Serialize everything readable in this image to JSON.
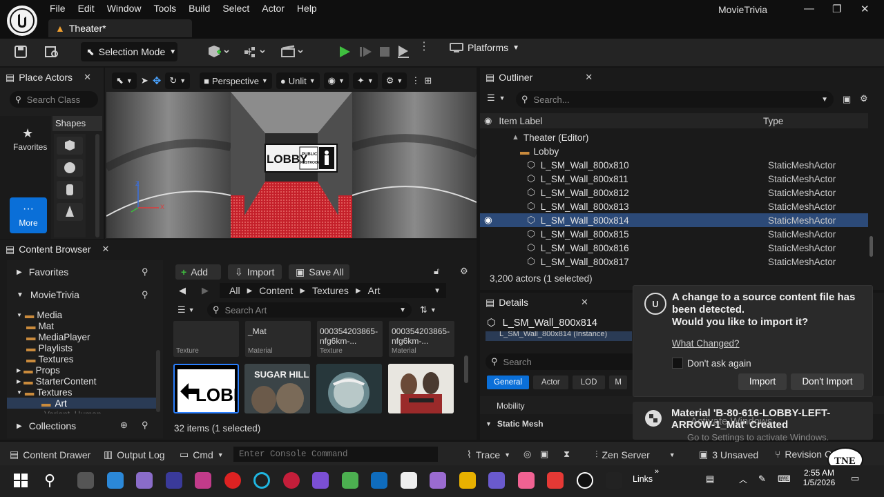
{
  "app": {
    "window_title": "MovieTrivia",
    "level_tab": "Theater*"
  },
  "menu": [
    "File",
    "Edit",
    "Window",
    "Tools",
    "Build",
    "Select",
    "Actor",
    "Help"
  ],
  "toolbar": {
    "selection_mode": "Selection Mode",
    "platforms": "Platforms"
  },
  "place_actors": {
    "title": "Place Actors",
    "search_placeholder": "Search Class",
    "favorites": "Favorites",
    "more": "More",
    "shapes": "Shapes"
  },
  "viewport": {
    "perspective": "Perspective",
    "unlit": "Unlit",
    "sign_lobby": "LOBBY",
    "sign_public": "PUBLIC",
    "sign_restroom": "RESTROOM",
    "axis_z": "Z",
    "axis_x": "X"
  },
  "outliner": {
    "title": "Outliner",
    "search_placeholder": "Search...",
    "col_label": "Item Label",
    "col_type": "Type",
    "root": "Theater (Editor)",
    "folder": "Lobby",
    "rows": [
      {
        "label": "L_SM_Wall_800x810",
        "type": "StaticMeshActor"
      },
      {
        "label": "L_SM_Wall_800x811",
        "type": "StaticMeshActor"
      },
      {
        "label": "L_SM_Wall_800x812",
        "type": "StaticMeshActor"
      },
      {
        "label": "L_SM_Wall_800x813",
        "type": "StaticMeshActor"
      },
      {
        "label": "L_SM_Wall_800x814",
        "type": "StaticMeshActor"
      },
      {
        "label": "L_SM_Wall_800x815",
        "type": "StaticMeshActor"
      },
      {
        "label": "L_SM_Wall_800x816",
        "type": "StaticMeshActor"
      },
      {
        "label": "L_SM_Wall_800x817",
        "type": "StaticMeshActor"
      }
    ],
    "status": "3,200 actors (1 selected)"
  },
  "content_browser": {
    "title": "Content Browser",
    "favorites": "Favorites",
    "project": "MovieTrivia",
    "tree": [
      "Media",
      "Mat",
      "MediaPlayer",
      "Playlists",
      "Textures",
      "Props",
      "StarterContent",
      "Textures",
      "Art"
    ],
    "tree_cut": "Variant_Human",
    "collections": "Collections",
    "add": "Add",
    "import": "Import",
    "save_all": "Save All",
    "breadcrumb": [
      "All",
      "Content",
      "Textures",
      "Art"
    ],
    "search_placeholder": "Search Art",
    "assets_top": [
      {
        "name": "",
        "type": "Texture"
      },
      {
        "name": "_Mat",
        "type": "Material"
      },
      {
        "name": "000354203865-nfg6km-...",
        "type": "Texture"
      },
      {
        "name": "000354203865-nfg6km-...",
        "type": "Material"
      }
    ],
    "thumb_lobby": "LOBBY",
    "thumb_sugarhill": "SUGAR HILL",
    "status": "32 items (1 selected)"
  },
  "details": {
    "title": "Details",
    "actor": "L_SM_Wall_800x814",
    "instance": "L_SM_Wall_800x814 (Instance)",
    "search_placeholder": "Search",
    "tabs": [
      "General",
      "Actor",
      "LOD",
      "M"
    ],
    "mobility": "Mobility",
    "static_mesh": "Static Mesh"
  },
  "notification": {
    "title": "A change to a source content file has been detected.",
    "question": "Would you like to import it?",
    "what_changed": "What Changed?",
    "dont_ask": "Don't ask again",
    "import": "Import",
    "dont_import": "Don't Import"
  },
  "notification2": {
    "text": "Material 'B-80-616-LOBBY-LEFT-ARROW-1_Mat' Created"
  },
  "watermark": {
    "line1": "Activate Windows",
    "line2": "Go to Settings to activate Windows."
  },
  "bottombar": {
    "content_drawer": "Content Drawer",
    "output_log": "Output Log",
    "cmd": "Cmd",
    "console_placeholder": "Enter Console Command",
    "trace": "Trace",
    "zen": "Zen Server",
    "unsaved": "3 Unsaved",
    "revision": "Revision C"
  },
  "taskbar": {
    "links": "Links",
    "time": "2:55 AM",
    "date": "1/5/2026",
    "m365": "M365"
  },
  "colors": {
    "accent": "#0070e0",
    "selected_row": "#2c4a78",
    "play_green": "#3fbf3f",
    "folder_orange": "#c98a3c"
  }
}
